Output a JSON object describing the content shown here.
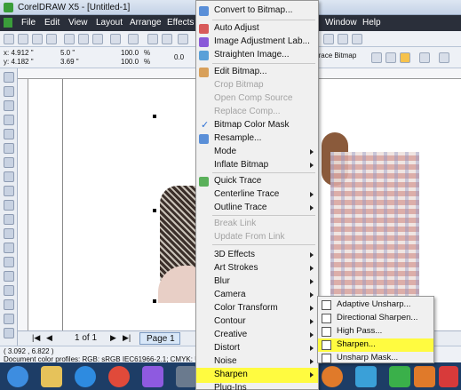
{
  "window": {
    "title": "CorelDRAW X5 - [Untitled-1]"
  },
  "menubar": [
    "File",
    "Edit",
    "View",
    "Layout",
    "Arrange",
    "Effects",
    "Window",
    "Help"
  ],
  "propbar": {
    "x": "x: 4.912 \"",
    "y": "y: 4.182 \"",
    "w": "5.0 \"",
    "h": "3.69 \"",
    "scale1": "100.0",
    "scale2": "100.0",
    "pct1": "%",
    "pct2": "%",
    "angle": "0.0",
    "trace_bitmap": "Trace Bitmap"
  },
  "bottom": {
    "page_count": "1 of 1",
    "page_tab": "Page 1",
    "coords": "( 3.092 , 6.822 )"
  },
  "status": {
    "profiles": "Document color profiles: RGB: sRGB IEC61966-2.1; CMYK: U.S. W"
  },
  "bitmaps_menu": {
    "convert": "Convert to Bitmap...",
    "auto_adjust": "Auto Adjust",
    "image_adjustment": "Image Adjustment Lab...",
    "straighten": "Straighten Image...",
    "edit_bitmap": "Edit Bitmap...",
    "crop_bitmap": "Crop Bitmap",
    "open_comp": "Open Comp Source",
    "replace_comp": "Replace Comp...",
    "color_mask": "Bitmap Color Mask",
    "resample": "Resample...",
    "mode": "Mode",
    "inflate": "Inflate Bitmap",
    "quick_trace": "Quick Trace",
    "centerline_trace": "Centerline Trace",
    "outline_trace": "Outline Trace",
    "break_link": "Break Link",
    "update_link": "Update From Link",
    "effects_3d": "3D Effects",
    "art_strokes": "Art Strokes",
    "blur": "Blur",
    "camera": "Camera",
    "color_transform": "Color Transform",
    "contour": "Contour",
    "creative": "Creative",
    "distort": "Distort",
    "noise": "Noise",
    "sharpen": "Sharpen",
    "plugins": "Plug-Ins"
  },
  "sharpen_submenu": {
    "adaptive": "Adaptive Unsharp...",
    "directional": "Directional Sharpen...",
    "high_pass": "High Pass...",
    "sharpen": "Sharpen...",
    "unsharp": "Unsharp Mask..."
  },
  "colors": {
    "highlight": "#fffb40",
    "menubar": "#2a2f3a",
    "taskbar": "#1d3d66"
  }
}
